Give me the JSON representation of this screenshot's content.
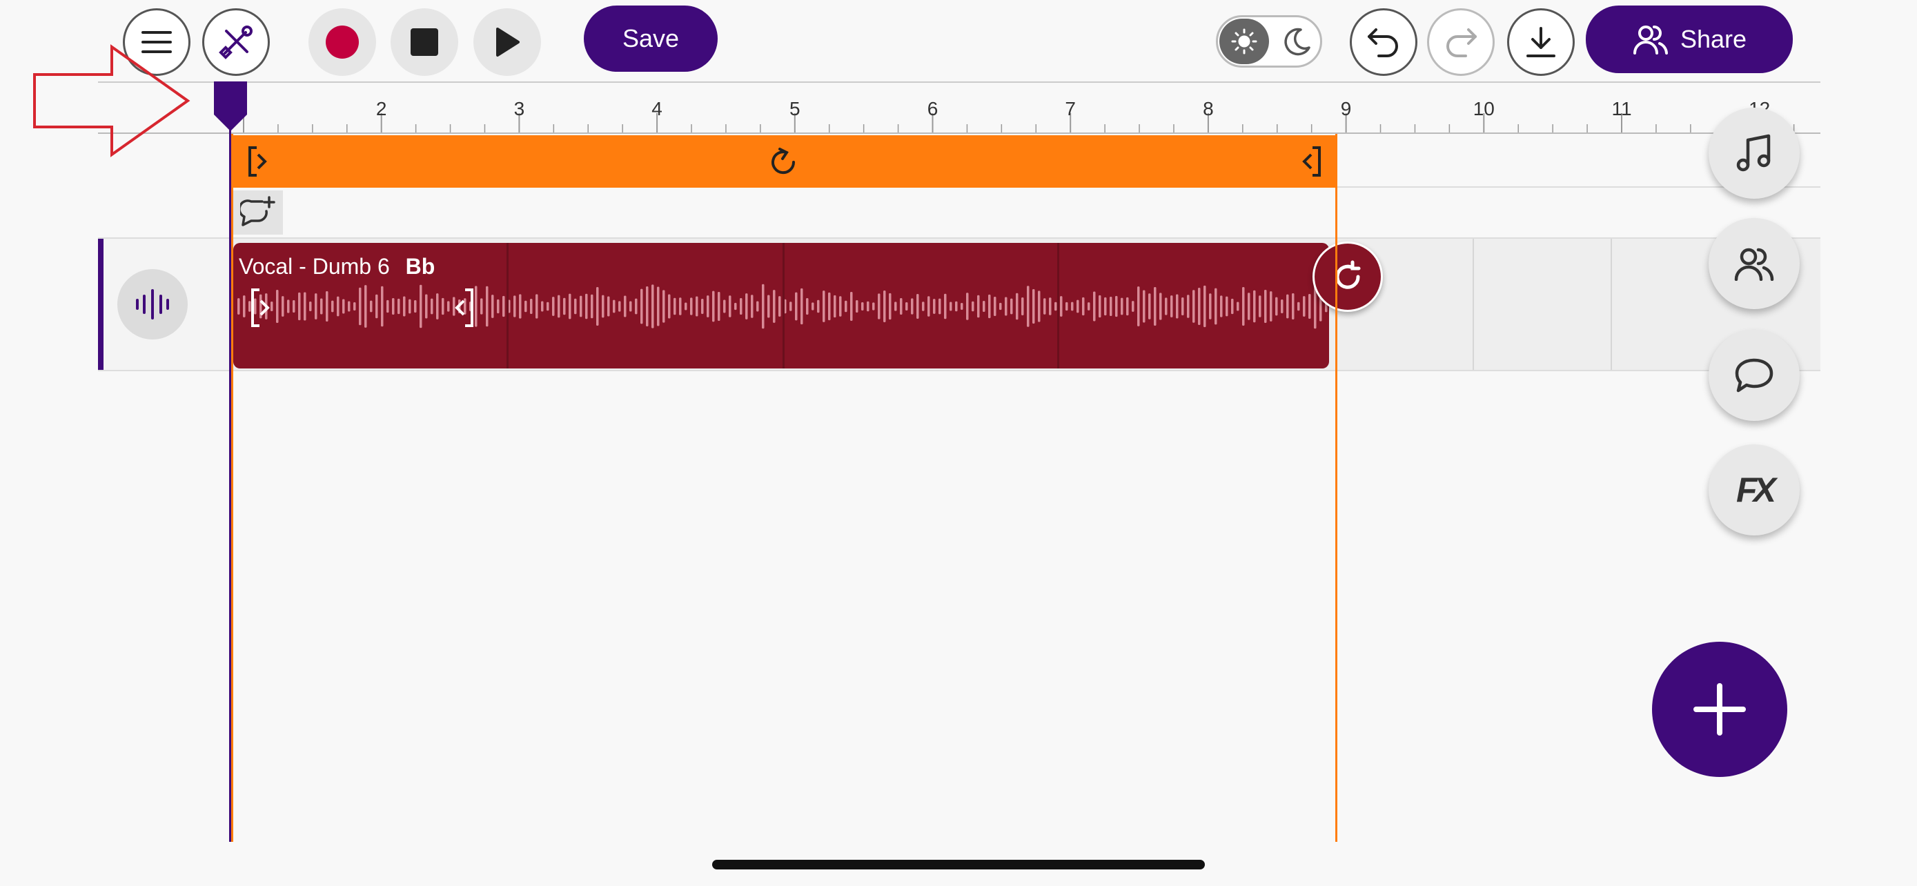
{
  "toolbar": {
    "menu_icon": "hamburger-menu-icon",
    "tools_icon": "tools-icon",
    "record_icon": "record-icon",
    "stop_icon": "stop-icon",
    "play_icon": "play-icon",
    "save_label": "Save",
    "theme_light_icon": "sun-icon",
    "theme_dark_icon": "moon-icon",
    "undo_icon": "undo-icon",
    "redo_icon": "redo-icon",
    "download_icon": "download-icon",
    "share_label": "Share",
    "share_icon": "users-icon"
  },
  "ruler": {
    "labels": [
      "2",
      "3",
      "4",
      "5",
      "6",
      "7",
      "8",
      "9",
      "10",
      "11",
      "12"
    ]
  },
  "track": {
    "clip_title": "Vocal - Dumb 6",
    "clip_key": "Bb",
    "track_icon": "waveform-icon"
  },
  "side_panel": {
    "items": [
      "music-note-icon",
      "collaborators-icon",
      "comment-icon",
      "fx-icon"
    ],
    "fx_label": "FX"
  },
  "fab": {
    "icon": "plus-icon"
  },
  "colors": {
    "brand": "#3f0a7a",
    "loop": "#ff7d0d",
    "clip": "#851325",
    "record": "#c2003e"
  }
}
